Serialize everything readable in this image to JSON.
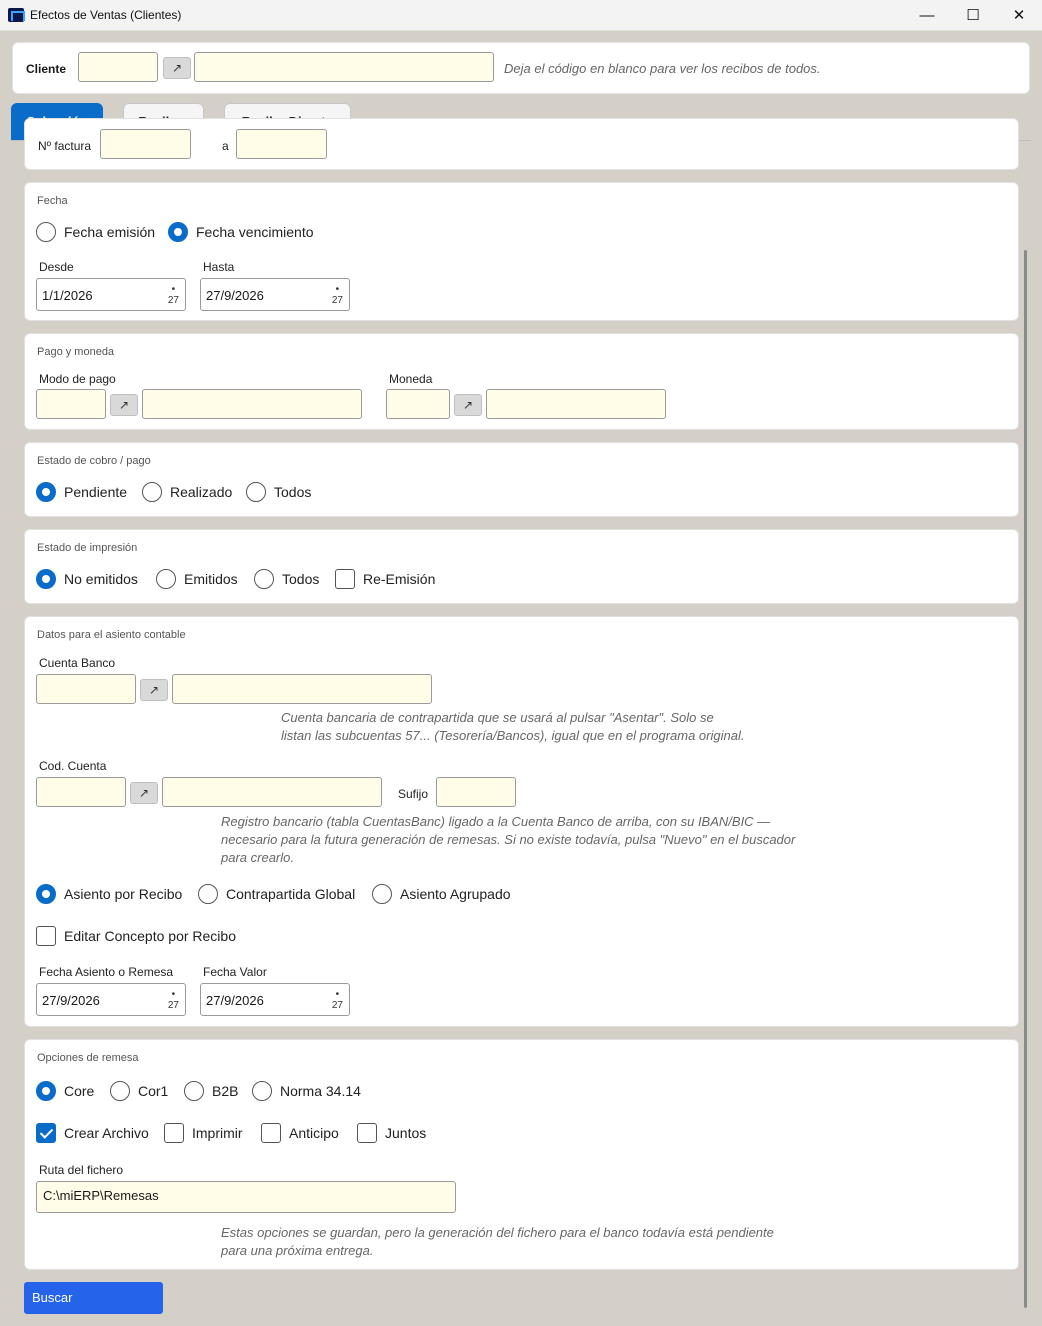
{
  "window": {
    "title": "Efectos de Ventas (Clientes)",
    "minimize": "—",
    "maximize": "☐",
    "close": "✕"
  },
  "cliente": {
    "label": "Cliente",
    "code": "",
    "name": "",
    "hint": "Deja el código en blanco para ver los recibos de todos."
  },
  "lookup_glyph": "↗",
  "tabs": [
    {
      "label": "Selección"
    },
    {
      "label": "Recibos"
    },
    {
      "label": "Recibo Directo"
    }
  ],
  "factura": {
    "label": "Nº factura",
    "to_label": "a",
    "from": "",
    "to": ""
  },
  "fecha": {
    "title": "Fecha",
    "options": [
      {
        "label": "Fecha emisión",
        "selected": false
      },
      {
        "label": "Fecha vencimiento",
        "selected": true
      }
    ],
    "desde_label": "Desde",
    "desde": "1/1/2026",
    "hasta_label": "Hasta",
    "hasta": "27/9/2026",
    "cal_dot": "•",
    "cal_num": "27"
  },
  "pago": {
    "title": "Pago y moneda",
    "modo_label": "Modo de pago",
    "modo_code": "",
    "modo_name": "",
    "moneda_label": "Moneda",
    "moneda_code": "",
    "moneda_name": ""
  },
  "estado_cobro": {
    "title": "Estado de cobro / pago",
    "options": [
      {
        "label": "Pendiente",
        "selected": true
      },
      {
        "label": "Realizado",
        "selected": false
      },
      {
        "label": "Todos",
        "selected": false
      }
    ]
  },
  "estado_impresion": {
    "title": "Estado de impresión",
    "options": [
      {
        "label": "No emitidos",
        "selected": true
      },
      {
        "label": "Emitidos",
        "selected": false
      },
      {
        "label": "Todos",
        "selected": false
      }
    ],
    "reemision": {
      "label": "Re-Emisión",
      "checked": false
    }
  },
  "asiento": {
    "title": "Datos para el asiento contable",
    "cuenta_banco_label": "Cuenta Banco",
    "cuenta_banco_code": "",
    "cuenta_banco_name": "",
    "cuenta_banco_hint_1": "Cuenta bancaria de contrapartida que se usará al pulsar \"Asentar\". Solo se",
    "cuenta_banco_hint_2": "listan las subcuentas 57... (Tesorería/Bancos), igual que en el programa original.",
    "cod_cuenta_label": "Cod. Cuenta",
    "cod_cuenta_code": "",
    "cod_cuenta_name": "",
    "sufijo_label": "Sufijo",
    "sufijo": "",
    "cod_hint_1": "Registro bancario (tabla CuentasBanc) ligado a la Cuenta Banco de arriba, con su IBAN/BIC —",
    "cod_hint_2": "necesario para la futura generación de remesas. Si no existe todavía, pulsa \"Nuevo\" en el buscador",
    "cod_hint_3": "para crearlo.",
    "modo_options": [
      {
        "label": "Asiento por Recibo",
        "selected": true
      },
      {
        "label": "Contrapartida Global",
        "selected": false
      },
      {
        "label": "Asiento Agrupado",
        "selected": false
      }
    ],
    "editar_concepto": {
      "label": "Editar Concepto por Recibo",
      "checked": false
    },
    "fecha_asiento_label": "Fecha Asiento o Remesa",
    "fecha_asiento": "27/9/2026",
    "fecha_valor_label": "Fecha Valor",
    "fecha_valor": "27/9/2026"
  },
  "remesa": {
    "title": "Opciones de remesa",
    "norma_options": [
      {
        "label": "Core",
        "selected": true
      },
      {
        "label": "Cor1",
        "selected": false
      },
      {
        "label": "B2B",
        "selected": false
      },
      {
        "label": "Norma 34.14",
        "selected": false
      }
    ],
    "checks": [
      {
        "label": "Crear Archivo",
        "checked": true
      },
      {
        "label": "Imprimir",
        "checked": false
      },
      {
        "label": "Anticipo",
        "checked": false
      },
      {
        "label": "Juntos",
        "checked": false
      }
    ],
    "ruta_label": "Ruta del fichero",
    "ruta": "C:\\miERP\\Remesas",
    "hint_1": "Estas opciones se guardan, pero la generación del fichero para el banco todavía está pendiente",
    "hint_2": "para una próxima entrega."
  },
  "buscar_label": "Buscar",
  "colors": {
    "accent": "#0a6cc9",
    "button": "#2563eb",
    "field_bg": "#fffde8",
    "window_bg": "#d4d0c8"
  }
}
